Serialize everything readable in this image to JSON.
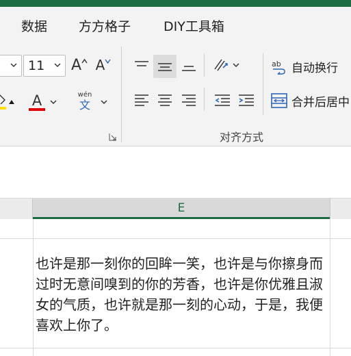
{
  "tabs": [
    "数据",
    "方方格子",
    "DIY工具箱"
  ],
  "font": {
    "font_name_value": "",
    "font_size_value": "11",
    "increase_font_glyph": "A",
    "decrease_font_glyph": "A",
    "font_color_glyph": "A",
    "font_color": "#e00000",
    "highlight_color": "#ffe000",
    "phonetic_top": "wén",
    "phonetic_bottom": "文"
  },
  "alignment": {
    "wrap_text_label": "自动换行",
    "merge_center_label": "合并后居中",
    "group_label": "对齐方式"
  },
  "sheet": {
    "column_label": "E",
    "cell_text": "也许是那一刻你的回眸一笑，也许是与你擦身而过时无意间嗅到的你的芳香，也许是你优雅且淑女的气质，也许就是那一刻的心动，于是，我便喜欢上你了。"
  },
  "accent_color": "#1e6c41"
}
